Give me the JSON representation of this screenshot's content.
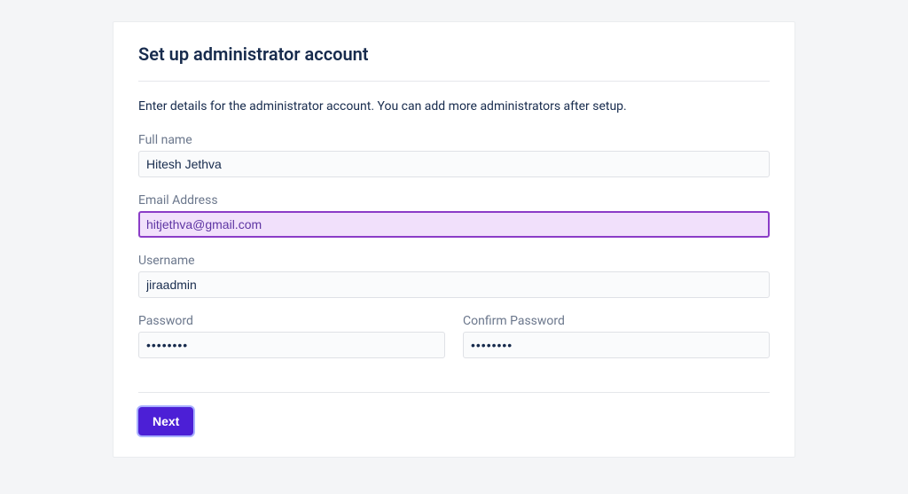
{
  "page": {
    "title": "Set up administrator account",
    "description": "Enter details for the administrator account. You can add more administrators after setup."
  },
  "form": {
    "full_name": {
      "label": "Full name",
      "value": "Hitesh Jethva"
    },
    "email": {
      "label": "Email Address",
      "value": "hitjethva@gmail.com"
    },
    "username": {
      "label": "Username",
      "value": "jiraadmin"
    },
    "password": {
      "label": "Password",
      "value": "••••••••"
    },
    "confirm_password": {
      "label": "Confirm Password",
      "value": "••••••••"
    }
  },
  "buttons": {
    "next": "Next"
  }
}
